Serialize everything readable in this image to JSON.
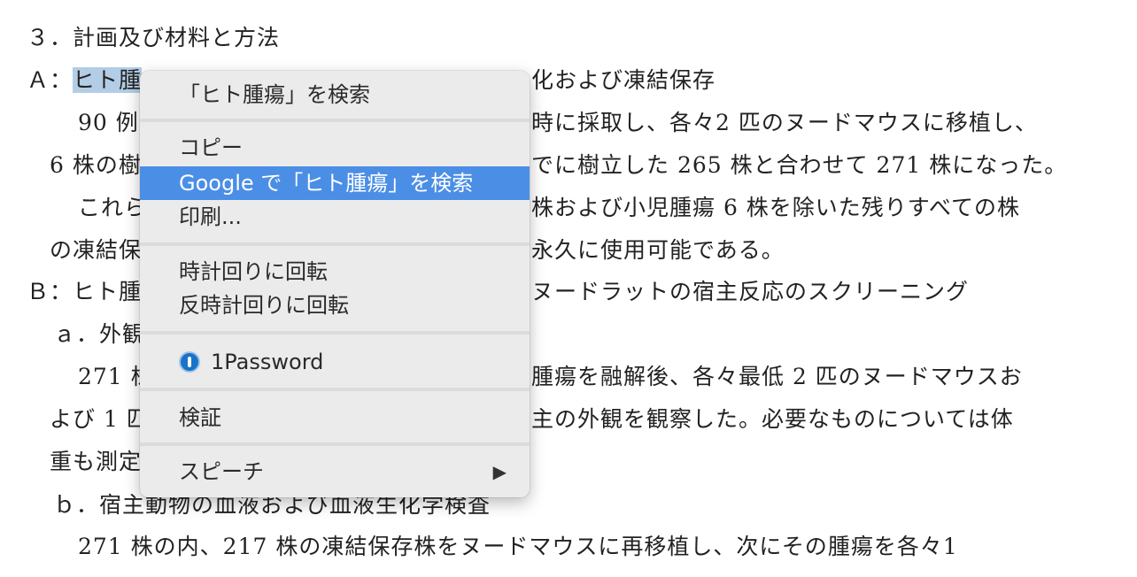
{
  "document": {
    "heading": "３．計画及び材料と方法",
    "line_a_prefix": "Ａ：",
    "line_a_selected": "ヒト腫",
    "line_a_rest": "化および凍結保存",
    "line2": "90 例",
    "line2_rest": "時に採取し、各々2 匹のヌードマウスに移植し、",
    "line3": "6 株の樹",
    "line3_rest": "でに樹立した 265 株と合わせて 271 株になった。",
    "line4": "これら",
    "line4_rest": "株および小児腫瘍 6 株を除いた残りすべての株",
    "line5": "の凍結保",
    "line5_rest": "永久に使用可能である。",
    "line6": "Ｂ：ヒト腫",
    "line6_rest": "ヌードラットの宿主反応のスクリーニング",
    "line7": "ａ．外観",
    "line8": "271 株",
    "line8_rest": "腫瘍を融解後、各々最低 2 匹のヌードマウスお",
    "line9": "よび 1 匹",
    "line9_rest": "主の外観を観察した。必要なものについては体",
    "line10": "重も測定",
    "line11": "ｂ．宿主動物の血液および血液生化学検査",
    "line12": "271 株の内、217 株の凍結保存株をヌードマウスに再移植し、次にその腫瘍を各々1"
  },
  "context_menu": {
    "search_selection": "「ヒト腫瘍」を検索",
    "copy": "コピー",
    "google_search": "Google で「ヒト腫瘍」を検索",
    "print": "印刷...",
    "rotate_cw": "時計回りに回転",
    "rotate_ccw": "反時計回りに回転",
    "onepassword": "1Password",
    "inspect": "検証",
    "speech": "スピーチ",
    "submenu_arrow": "▶",
    "highlight_color": "#4b8ee6"
  }
}
